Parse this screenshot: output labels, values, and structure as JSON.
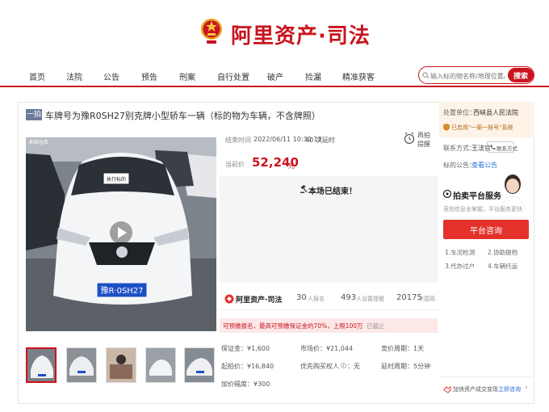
{
  "header": {
    "logo_text": "阿里资产·司法"
  },
  "nav": {
    "items": [
      "首页",
      "法院",
      "公告",
      "预告",
      "刑案",
      "自行处置",
      "破产",
      "捡漏",
      "精准获客"
    ]
  },
  "search": {
    "placeholder": "输入标的物名称/地理位置/执行案号",
    "button_label": "搜索"
  },
  "lot": {
    "tag": "一拍",
    "title": "车牌号为豫R0SH27别克牌小型轿车一辆（标的物为车辆，不含牌照）"
  },
  "photo": {
    "watermark": "影相仓库",
    "sign": "执行标的",
    "plate": "豫R·0SH27"
  },
  "auction": {
    "end_time_label": "结束时间",
    "end_time_value": "2022/06/11 10:30:13",
    "extend_count": "40 次延时",
    "price_label": "当前价",
    "price_value": "52,240",
    "price_unit": "元",
    "remind_label": "再拍\n提醒",
    "ended_text": "本场已结束！"
  },
  "stats": {
    "brand": "阿里资产·司法",
    "signups_num": "30",
    "signups_label": "人报名",
    "reminders_num": "493",
    "reminders_label": "人设置提醒",
    "views_num": "20175",
    "views_label": "次围观"
  },
  "notice": {
    "text": "可预缴报名，最高可预缴保证金的70%，上限100万",
    "status": "已截止"
  },
  "details": {
    "deposit": "保证金：¥1,600",
    "market_price": "市场价：¥21,044",
    "bid_cycle": "竞价周期：1天",
    "start_price": "起拍价：¥16,840",
    "priority": "优先购买权人",
    "priority_value": "：无",
    "delay_cycle": "延时周期：5分钟",
    "increment": "加价幅度：¥300"
  },
  "sidebar": {
    "unit_label": "处置单位：",
    "unit_value": "西峡县人民法院",
    "system_badge": "已启用\"一案一账号\"系统",
    "contact_label": "联系方式：",
    "contact_name": "王法官",
    "contact_button": "联系方式",
    "notice_label": "标的公告：",
    "notice_link": "查看公告",
    "service_title": "拍卖平台服务",
    "service_desc": "竞拍信息全掌握，平台服务更快",
    "consult_label": "平台咨询",
    "services": [
      "1.车况检测",
      "2.协助提档",
      "3.代办过户",
      "4.车辆托运"
    ],
    "subscribe_text": "加快资产成交变现",
    "subscribe_link": "立即咨询"
  },
  "colors": {
    "brand_red": "#c9141f",
    "price_red": "#c9141f"
  }
}
